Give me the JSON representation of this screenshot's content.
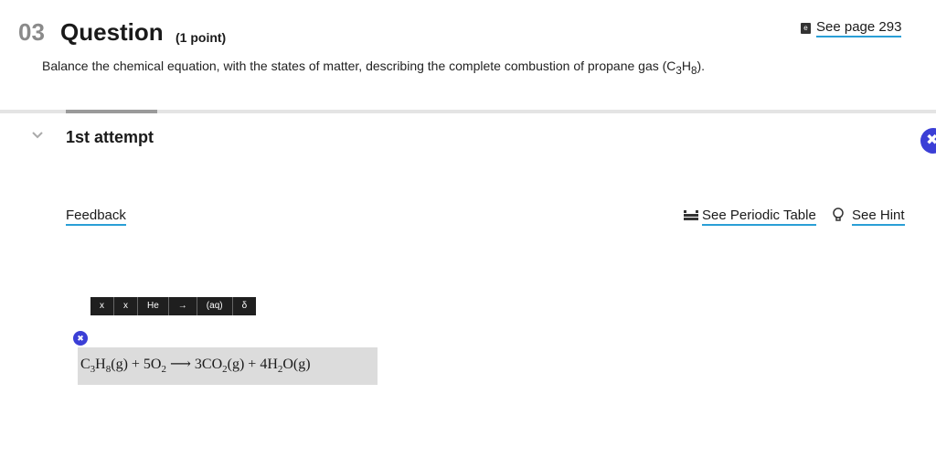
{
  "header": {
    "number": "03",
    "title": "Question",
    "points": "(1 point)",
    "see_page": "See page 293",
    "ebook_icon": "e-icon"
  },
  "prompt": {
    "text_before": "Balance the chemical equation, with the states of matter, describing the complete combustion of propane gas (C",
    "sub1": "3",
    "mid": "H",
    "sub2": "8",
    "text_after": ")."
  },
  "attempt": {
    "label": "1st attempt",
    "chevron": "chevron-down-icon",
    "remove_icon": "close-icon"
  },
  "links": {
    "feedback": "Feedback",
    "periodic_table": "See Periodic Table",
    "hint": "See Hint"
  },
  "toolbar": {
    "items": [
      "x",
      "x",
      "He",
      "→",
      "(aq)",
      "δ"
    ]
  },
  "answer": {
    "parts": [
      "C",
      "3",
      "H",
      "8",
      "(g) + 5O",
      "2",
      " ⟶ 3CO",
      "2",
      "(g) + 4H",
      "2",
      "O(g)"
    ]
  }
}
